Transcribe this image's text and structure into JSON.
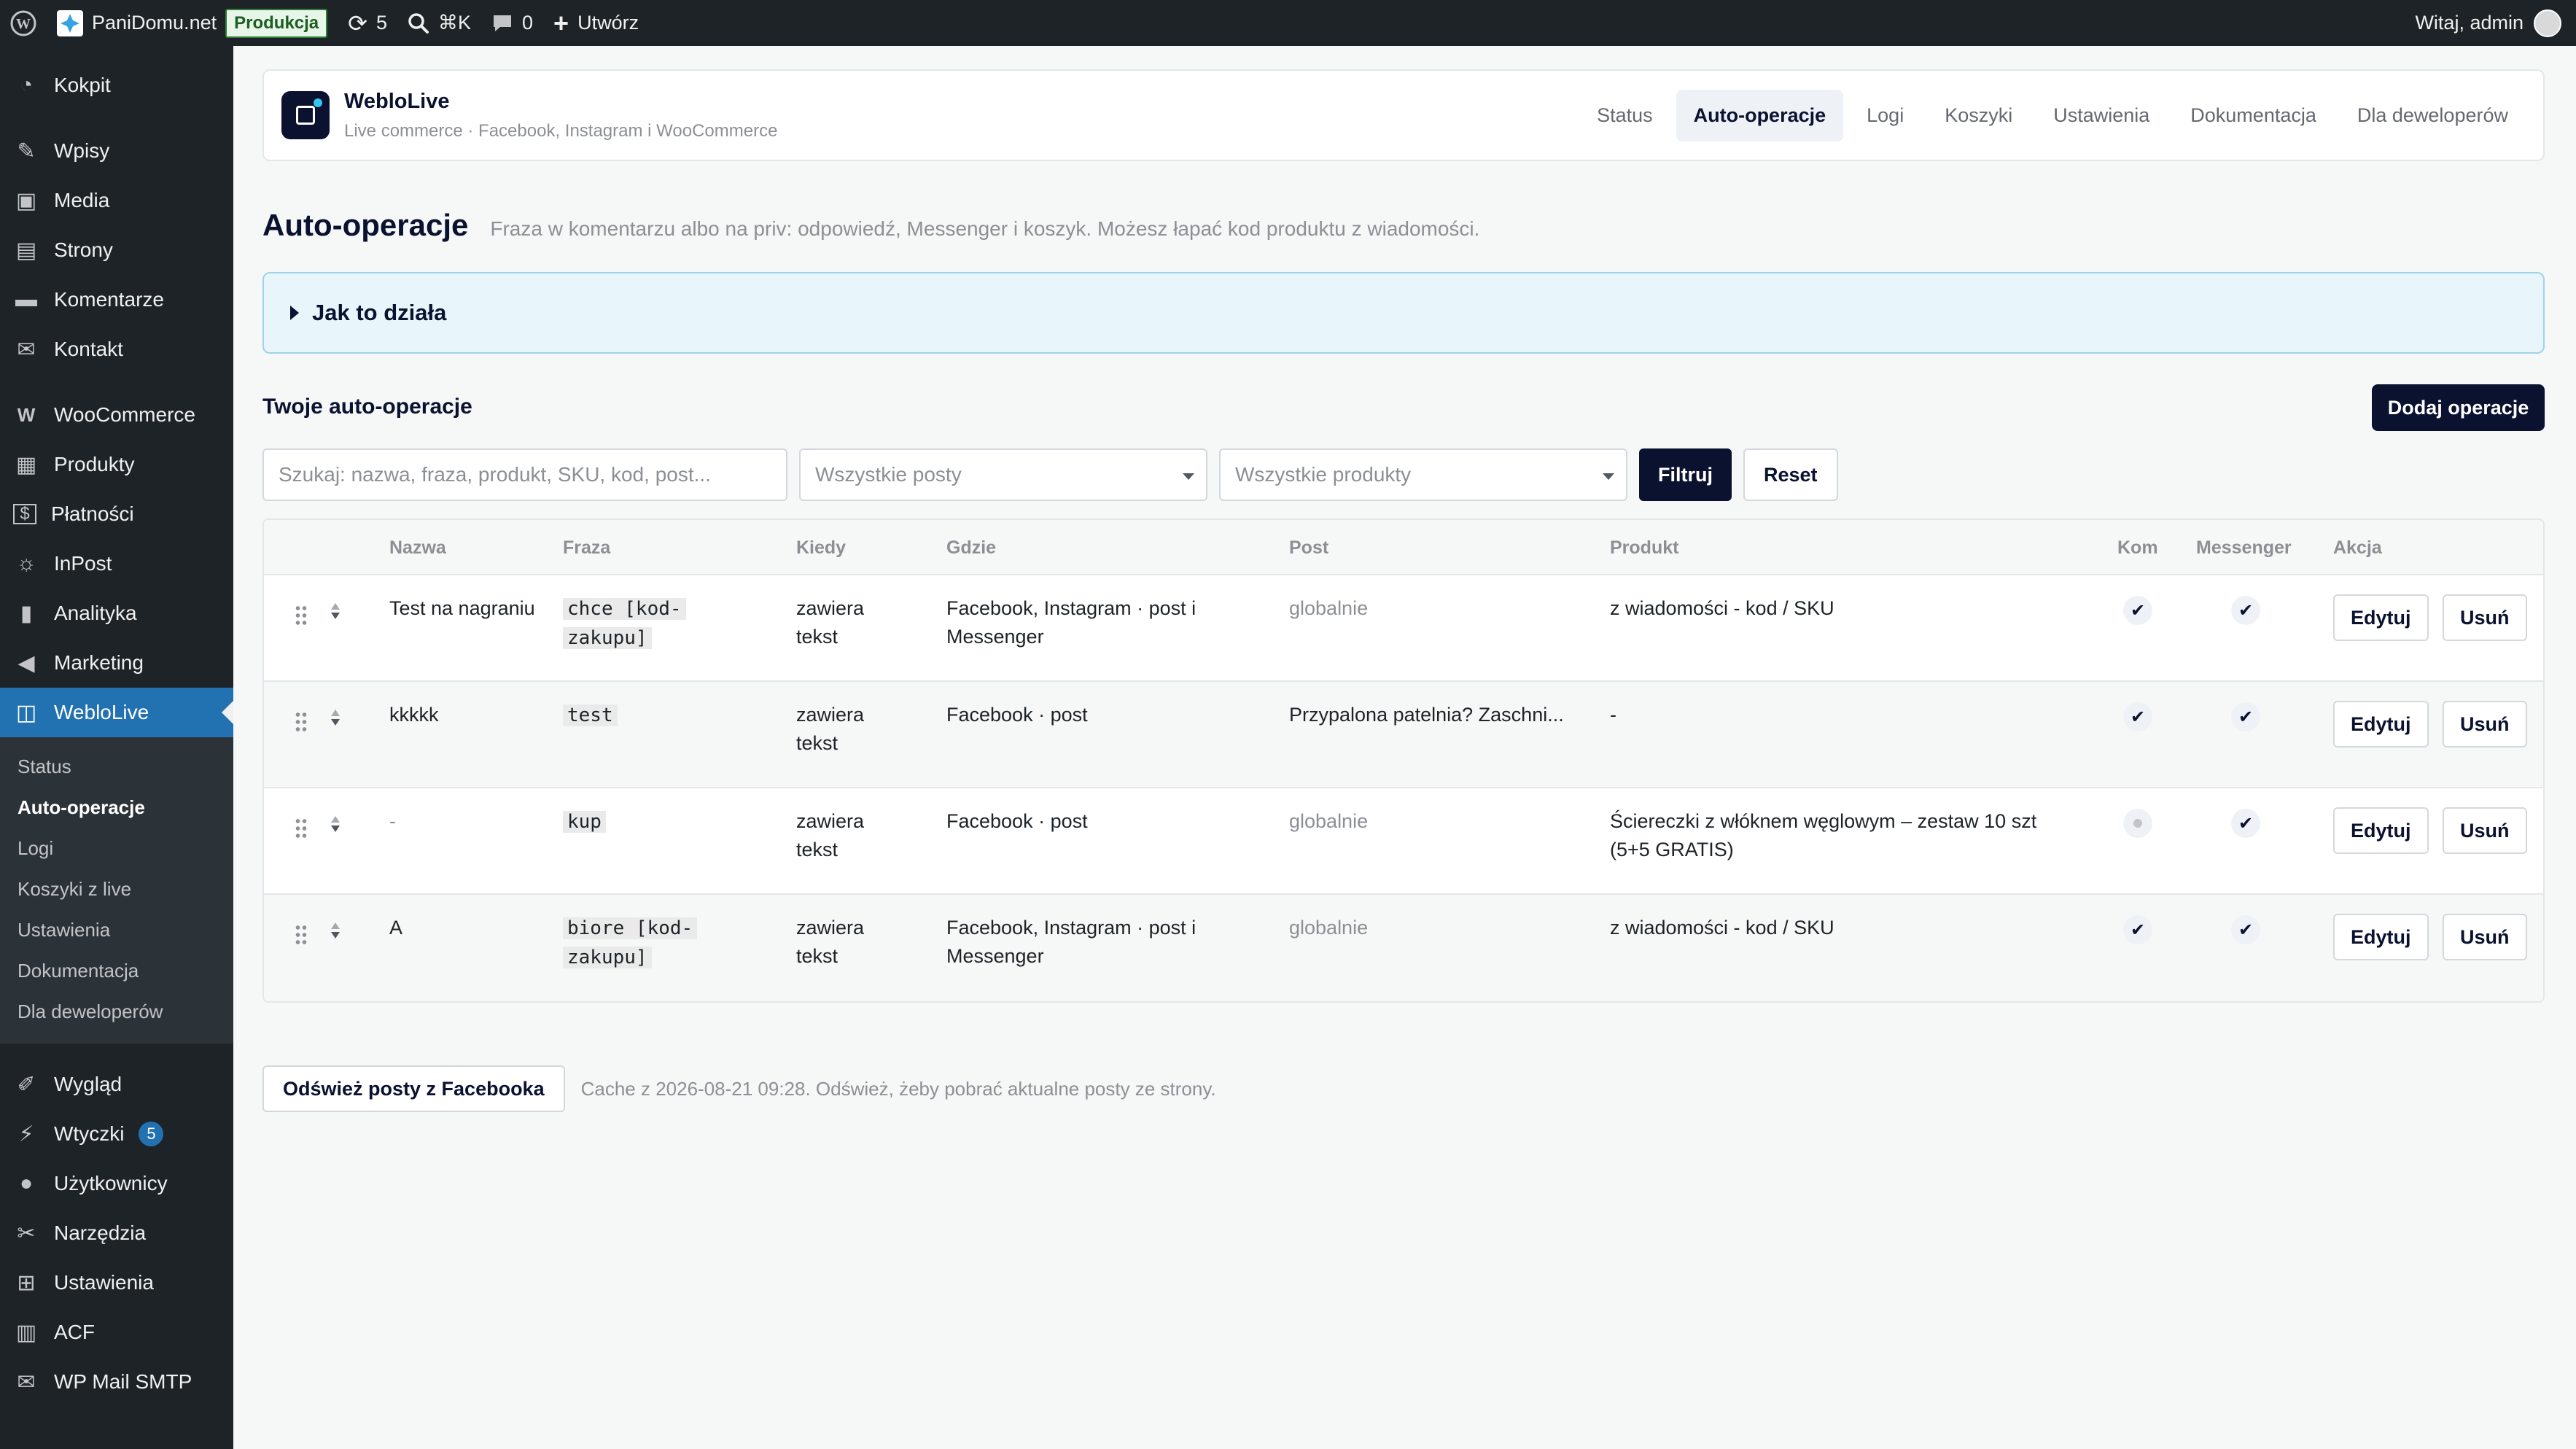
{
  "adminbar": {
    "site_name": "PaniDomu.net",
    "env_badge": "Produkcja",
    "updates_count": "5",
    "search_shortcut": "⌘K",
    "comments_count": "0",
    "create_label": "Utwórz",
    "greeting": "Witaj, admin"
  },
  "sidebar": {
    "items": [
      {
        "label": "Kokpit",
        "icon": "dashboard-icon"
      },
      {
        "label": "Wpisy",
        "icon": "pin-icon"
      },
      {
        "label": "Media",
        "icon": "media-icon"
      },
      {
        "label": "Strony",
        "icon": "pages-icon"
      },
      {
        "label": "Komentarze",
        "icon": "comments-icon"
      },
      {
        "label": "Kontakt",
        "icon": "mail-icon"
      },
      {
        "label": "WooCommerce",
        "icon": "woocommerce-icon"
      },
      {
        "label": "Produkty",
        "icon": "products-icon"
      },
      {
        "label": "Płatności",
        "icon": "payments-icon"
      },
      {
        "label": "InPost",
        "icon": "inpost-icon"
      },
      {
        "label": "Analityka",
        "icon": "analytics-icon"
      },
      {
        "label": "Marketing",
        "icon": "megaphone-icon"
      },
      {
        "label": "WebloLive",
        "icon": "weblolive-icon"
      },
      {
        "label": "Wygląd",
        "icon": "appearance-icon"
      },
      {
        "label": "Wtyczki",
        "icon": "plugins-icon",
        "badge": "5"
      },
      {
        "label": "Użytkownicy",
        "icon": "users-icon"
      },
      {
        "label": "Narzędzia",
        "icon": "tools-icon"
      },
      {
        "label": "Ustawienia",
        "icon": "settings-icon"
      },
      {
        "label": "ACF",
        "icon": "acf-icon"
      },
      {
        "label": "WP Mail SMTP",
        "icon": "mail-smtp-icon"
      }
    ],
    "submenu": [
      "Status",
      "Auto-operacje",
      "Logi",
      "Koszyki z live",
      "Ustawienia",
      "Dokumentacja",
      "Dla deweloperów"
    ]
  },
  "plugin": {
    "name": "WebloLive",
    "tagline": "Live commerce · Facebook, Instagram i WooCommerce",
    "tabs": [
      "Status",
      "Auto-operacje",
      "Logi",
      "Koszyki",
      "Ustawienia",
      "Dokumentacja",
      "Dla deweloperów"
    ]
  },
  "page": {
    "title": "Auto-operacje",
    "description": "Fraza w komentarzu albo na priv: odpowiedź, Messenger i koszyk. Możesz łapać kod produktu z wiadomości.",
    "howto": "Jak to działa",
    "section_title": "Twoje auto-operacje",
    "add_button": "Dodaj operacje"
  },
  "filters": {
    "search_placeholder": "Szukaj: nazwa, fraza, produkt, SKU, kod, post...",
    "posts_select": "Wszystkie posty",
    "products_select": "Wszystkie produkty",
    "filter_button": "Filtruj",
    "reset_button": "Reset"
  },
  "table": {
    "headers": {
      "name": "Nazwa",
      "phrase": "Fraza",
      "when": "Kiedy",
      "where": "Gdzie",
      "post": "Post",
      "product": "Produkt",
      "kom": "Kom",
      "messenger": "Messenger",
      "action": "Akcja"
    },
    "edit_label": "Edytuj",
    "delete_label": "Usuń",
    "rows": [
      {
        "name": "Test na nagraniu",
        "phrase": "chce [kod-zakupu]",
        "when": "zawiera tekst",
        "where": "Facebook, Instagram · post i Messenger",
        "post": "globalnie",
        "post_muted": true,
        "product": "z wiadomości - kod / SKU",
        "kom": true,
        "messenger": true
      },
      {
        "name": "kkkkk",
        "phrase": "test",
        "when": "zawiera tekst",
        "where": "Facebook · post",
        "post": "Przypalona patelnia? Zaschni...",
        "post_muted": false,
        "product": "-",
        "kom": true,
        "messenger": true
      },
      {
        "name": "-",
        "phrase": "kup",
        "when": "zawiera tekst",
        "where": "Facebook · post",
        "post": "globalnie",
        "post_muted": true,
        "product": "Ściereczki z włóknem węglowym – zestaw 10 szt (5+5 GRATIS)",
        "kom": false,
        "messenger": true
      },
      {
        "name": "A",
        "phrase": "biore [kod-zakupu]",
        "when": "zawiera tekst",
        "where": "Facebook, Instagram · post i Messenger",
        "post": "globalnie",
        "post_muted": true,
        "product": "z wiadomości - kod / SKU",
        "kom": true,
        "messenger": true
      }
    ]
  },
  "footer": {
    "refresh_button": "Odśwież posty z Facebooka",
    "cache_note": "Cache z 2026-08-21 09:28. Odśwież, żeby pobrać aktualne posty ze strony."
  },
  "colors": {
    "admin_dark": "#1d2327",
    "accent_blue": "#2271b1",
    "navy": "#0b1230",
    "info_bg": "#e8f5fb"
  }
}
